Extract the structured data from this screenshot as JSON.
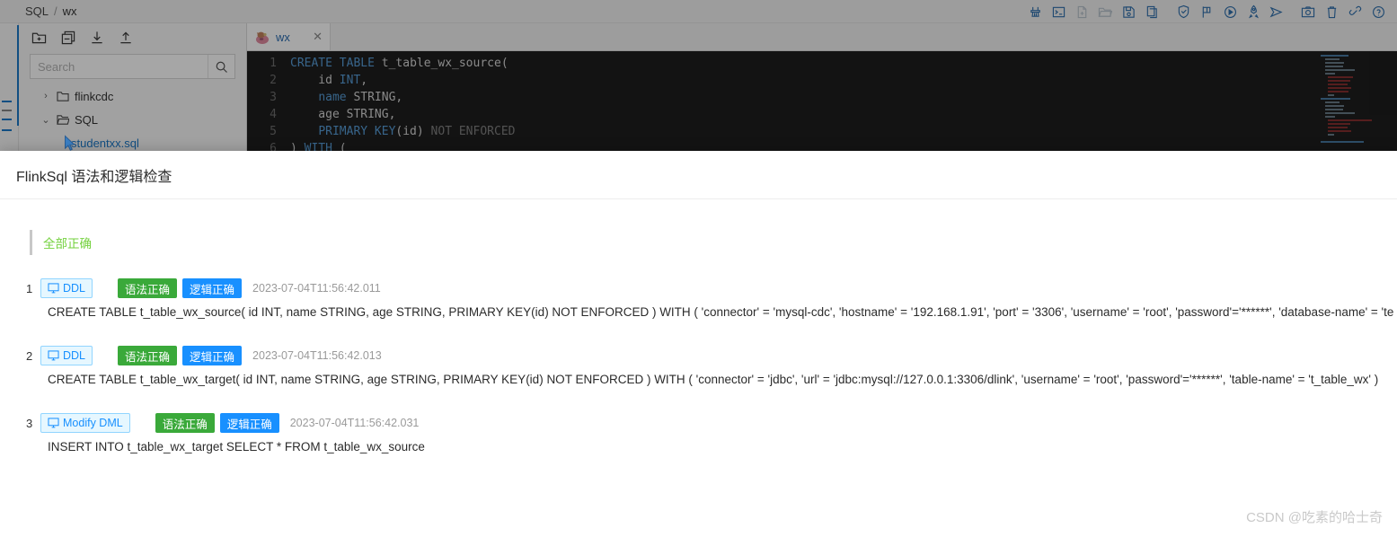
{
  "header": {
    "breadcrumb": [
      "SQL",
      "wx"
    ],
    "separator": "/",
    "icons": [
      {
        "name": "broom-icon",
        "label": "Format"
      },
      {
        "name": "terminal-icon",
        "label": "Console"
      },
      {
        "name": "new-file-icon",
        "label": "New File"
      },
      {
        "name": "open-folder-icon",
        "label": "Open"
      },
      {
        "name": "save-icon",
        "label": "Save"
      },
      {
        "name": "copy-icon",
        "label": "Copy"
      },
      {
        "name": "shield-check-icon",
        "label": "Check"
      },
      {
        "name": "flag-icon",
        "label": "Flag"
      },
      {
        "name": "play-circle-icon",
        "label": "Run"
      },
      {
        "name": "rocket-icon",
        "label": "Submit"
      },
      {
        "name": "send-icon",
        "label": "Send"
      },
      {
        "name": "camera-icon",
        "label": "Snapshot"
      },
      {
        "name": "trash-icon",
        "label": "Delete"
      },
      {
        "name": "link-icon",
        "label": "Link"
      },
      {
        "name": "help-icon",
        "label": "Help"
      }
    ]
  },
  "sidebar": {
    "tools": [
      {
        "name": "new-folder-icon",
        "label": "New Folder"
      },
      {
        "name": "new-tab-icon",
        "label": "New Tab"
      },
      {
        "name": "download-icon",
        "label": "Download"
      },
      {
        "name": "upload-icon",
        "label": "Upload"
      }
    ],
    "search": {
      "placeholder": "Search",
      "value": ""
    },
    "tree": [
      {
        "label": "flinkcdc",
        "expanded": false,
        "caret": "›"
      },
      {
        "label": "SQL",
        "expanded": true,
        "caret": "⌄"
      },
      {
        "label": "studentxx.sql",
        "expanded": false,
        "caret": ""
      }
    ]
  },
  "editor": {
    "tab": {
      "label": "wx",
      "close": "✕",
      "icon": "pig-icon"
    },
    "lines": [
      {
        "n": "1",
        "segments": [
          {
            "t": "CREATE",
            "c": "k"
          },
          {
            "t": " ",
            "c": ""
          },
          {
            "t": "TABLE",
            "c": "k"
          },
          {
            "t": " t_table_wx_source(",
            "c": ""
          }
        ]
      },
      {
        "n": "2",
        "segments": [
          {
            "t": "    id ",
            "c": ""
          },
          {
            "t": "INT",
            "c": "k"
          },
          {
            "t": ",",
            "c": ""
          }
        ]
      },
      {
        "n": "3",
        "segments": [
          {
            "t": "    ",
            "c": ""
          },
          {
            "t": "name",
            "c": "k"
          },
          {
            "t": " STRING,",
            "c": ""
          }
        ]
      },
      {
        "n": "4",
        "segments": [
          {
            "t": "    age STRING,",
            "c": ""
          }
        ]
      },
      {
        "n": "5",
        "segments": [
          {
            "t": "    ",
            "c": ""
          },
          {
            "t": "PRIMARY KEY",
            "c": "k"
          },
          {
            "t": "(id) ",
            "c": ""
          },
          {
            "t": "NOT ENFORCED",
            "c": "kg"
          }
        ]
      },
      {
        "n": "6",
        "segments": [
          {
            "t": ") ",
            "c": ""
          },
          {
            "t": "WITH",
            "c": "k"
          },
          {
            "t": " (",
            "c": ""
          }
        ]
      }
    ]
  },
  "modal": {
    "title": "FlinkSql 语法和逻辑检查",
    "alert": "全部正确",
    "alert_color": "#73d13d",
    "results": [
      {
        "index": "1",
        "type": "DDL",
        "syntax": "语法正确",
        "logic": "逻辑正确",
        "timestamp": "2023-07-04T11:56:42.011",
        "sql": "CREATE TABLE t_table_wx_source( id INT, name STRING, age STRING, PRIMARY KEY(id) NOT ENFORCED ) WITH ( 'connector' = 'mysql-cdc', 'hostname' = '192.168.1.91', 'port' = '3306', 'username' = 'root', 'password'='******', 'database-name' = 'te"
      },
      {
        "index": "2",
        "type": "DDL",
        "syntax": "语法正确",
        "logic": "逻辑正确",
        "timestamp": "2023-07-04T11:56:42.013",
        "sql": "CREATE TABLE t_table_wx_target( id INT, name STRING, age STRING, PRIMARY KEY(id) NOT ENFORCED ) WITH ( 'connector' = 'jdbc', 'url' = 'jdbc:mysql://127.0.0.1:3306/dlink', 'username' = 'root', 'password'='******', 'table-name' = 't_table_wx' )"
      },
      {
        "index": "3",
        "type": "Modify DML",
        "syntax": "语法正确",
        "logic": "逻辑正确",
        "timestamp": "2023-07-04T11:56:42.031",
        "sql": "INSERT INTO t_table_wx_target SELECT * FROM t_table_wx_source"
      }
    ]
  },
  "watermark": "CSDN @吃素的哈士奇",
  "colors": {
    "accent_blue": "#1890ff",
    "success_green": "#3aa93a",
    "alert_green": "#73d13d",
    "tag_bg": "#e6f7ff",
    "tag_border": "#91d5ff",
    "editor_bg": "#1e1e1e"
  }
}
